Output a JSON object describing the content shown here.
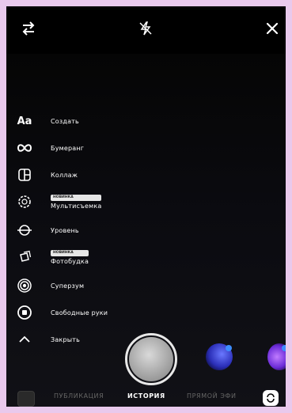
{
  "colors": {
    "page_border": "#e9c9ec",
    "background": "#000000",
    "text": "#ffffff",
    "inactive_tab": "#666666"
  },
  "top": {
    "flip_icon": "swap-arrows-icon",
    "flash_icon": "flash-off-icon",
    "close_icon": "close-icon"
  },
  "menu": {
    "items": [
      {
        "icon": "Aa",
        "label": "Создать"
      },
      {
        "icon": "infinity-icon",
        "label": "Бумеранг"
      },
      {
        "icon": "layout-icon",
        "label": "Коллаж"
      },
      {
        "icon": "multi-capture-icon",
        "label": "Мультисъемка",
        "badge": "НОВИНКА"
      },
      {
        "icon": "level-icon",
        "label": "Уровень"
      },
      {
        "icon": "photobooth-icon",
        "label": "Фотобудка",
        "badge": "НОВИНКА"
      },
      {
        "icon": "superzoom-icon",
        "label": "Суперзум"
      },
      {
        "icon": "hands-free-icon",
        "label": "Свободные руки"
      },
      {
        "icon": "chevron-up-icon",
        "label": "Закрыть"
      }
    ]
  },
  "bottom": {
    "tabs": [
      {
        "label": "ПУБЛИКАЦИЯ",
        "active": false
      },
      {
        "label": "ИСТОРИЯ",
        "active": true
      },
      {
        "label": "ПРЯМОЙ ЭФИ",
        "active": false
      }
    ],
    "gallery_icon": "gallery-thumbnail-icon",
    "switch_camera_icon": "switch-camera-icon"
  }
}
